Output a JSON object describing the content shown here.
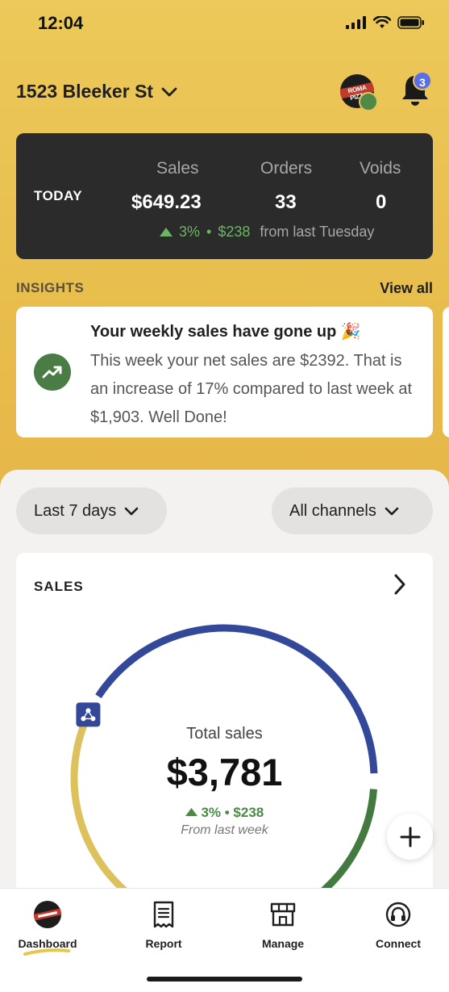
{
  "status_bar": {
    "time": "12:04"
  },
  "header": {
    "store_name": "1523 Bleeker St",
    "avatar_brand": "ROMA PIZZA",
    "notification_count": "3"
  },
  "today": {
    "label": "TODAY",
    "columns": [
      {
        "heading": "Sales",
        "value": "$649.23"
      },
      {
        "heading": "Orders",
        "value": "33"
      },
      {
        "heading": "Voids",
        "value": "0"
      }
    ],
    "change_pct": "3%",
    "change_amount": "$238",
    "change_from": "from last Tuesday"
  },
  "insights": {
    "title": "INSIGHTS",
    "view_all": "View all",
    "card": {
      "heading": "Your weekly sales have gone up 🎉",
      "body": "This week your net sales are $2392. That is an increase of 17% compared to last week at $1,903. Well Done!"
    }
  },
  "filters": {
    "period": "Last 7 days",
    "channel": "All channels"
  },
  "sales": {
    "title": "SALES",
    "total_label": "Total sales",
    "total_value": "$3,781",
    "change": "3% • $238",
    "change_from": "From last week"
  },
  "chart_data": {
    "type": "pie",
    "title": "Total sales",
    "series": [
      {
        "channel_icon": "share-nodes-icon",
        "value": 42,
        "color": "#34489a"
      },
      {
        "channel_icon": "phone-icon",
        "value": 35,
        "color": "#447a40"
      },
      {
        "value": 23,
        "color": "#dcc15c"
      }
    ]
  },
  "nav": {
    "items": [
      {
        "label": "Dashboard"
      },
      {
        "label": "Report"
      },
      {
        "label": "Manage"
      },
      {
        "label": "Connect"
      }
    ]
  },
  "colors": {
    "accent": "#e9c357",
    "positive": "#4a8a44",
    "dark_card": "#2b2b2b",
    "badge": "#5a6ee6"
  }
}
